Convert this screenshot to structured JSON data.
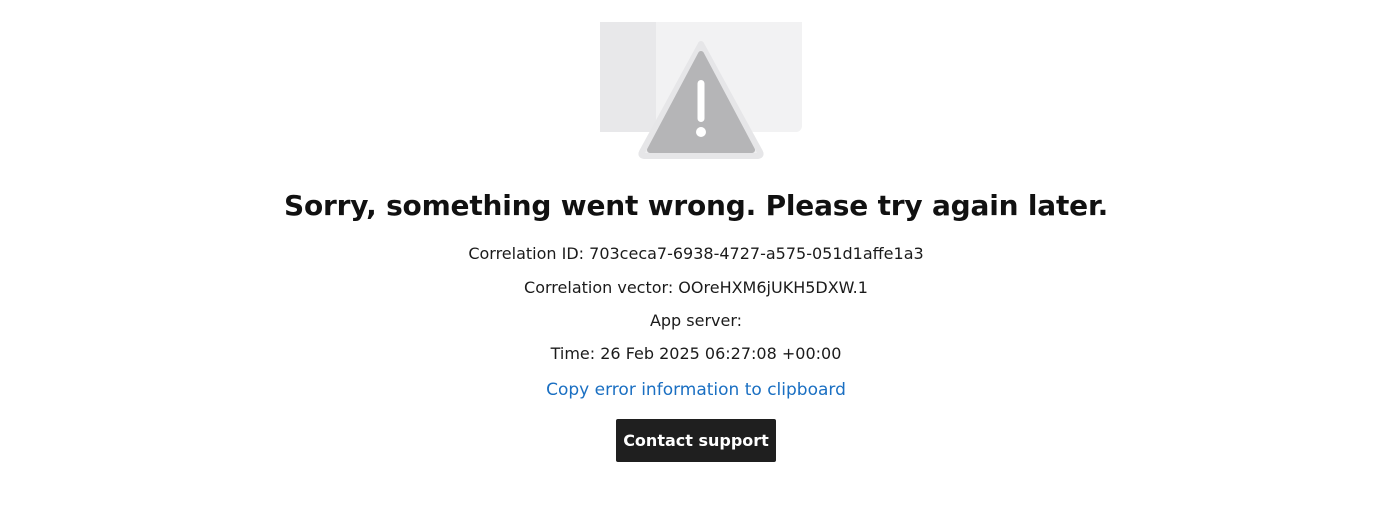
{
  "error": {
    "illustration_icon": "warning-triangle-icon",
    "title": "Sorry, something went wrong. Please try again later.",
    "correlation_id": "Correlation ID: 703ceca7-6938-4727-a575-051d1affe1a3",
    "correlation_vector": "Correlation vector: OOreHXM6jUKH5DXW.1",
    "app_server": "App server:",
    "time": "Time: 26 Feb 2025 06:27:08 +00:00",
    "copy_link": "Copy error information to clipboard",
    "contact_button": "Contact support"
  },
  "colors": {
    "link": "#1a6fc2",
    "button_bg": "#1f1f1f",
    "button_text": "#ffffff",
    "illustration_panel": "#f2f2f3",
    "illustration_panel_dark": "#e8e8ea",
    "triangle_fill": "#b5b5b7"
  }
}
